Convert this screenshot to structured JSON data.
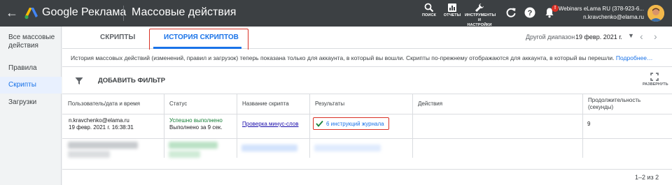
{
  "app": {
    "brand": "Google Реклама",
    "page_title": "Массовые действия"
  },
  "toolbar": {
    "search_label": "ПОИСК",
    "reports_label": "ОТЧЕТЫ",
    "tools_label_line1": "ИНСТРУМЕНТЫ",
    "tools_label_line2": "И",
    "tools_label_line3": "НАСТРОЙКИ",
    "notification_count": "!"
  },
  "account": {
    "name": "Webinars eLama RU (378-923-6...",
    "email": "n.kravchenko@elama.ru"
  },
  "sidebar": {
    "items": [
      {
        "label": "Все массовые действия"
      },
      {
        "label": "Правила"
      },
      {
        "label": "Скрипты"
      },
      {
        "label": "Загрузки"
      }
    ]
  },
  "tabs": [
    {
      "label": "СКРИПТЫ"
    },
    {
      "label": "ИСТОРИЯ СКРИПТОВ"
    }
  ],
  "date_range": {
    "label": "Другой диапазон",
    "value": "19 февр. 2021 г."
  },
  "info": {
    "text": "История массовых действий (изменений, правил и загрузок) теперь показана только для аккаунта, в который вы вошли. Скрипты по-прежнему отображаются для аккаунта, в который вы перешли.",
    "more_link": "Подробнее…"
  },
  "filter": {
    "label": "ДОБАВИТЬ ФИЛЬТР",
    "expand_label": "РАЗВЕРНУТЬ"
  },
  "table": {
    "headers": {
      "user": "Пользователь/дата и время",
      "status": "Статус",
      "script": "Название скрипта",
      "results": "Результаты",
      "actions": "Действия",
      "duration_line1": "Продолжительность",
      "duration_line2": "(секунды)"
    },
    "rows": [
      {
        "user": "n.kravchenko@elama.ru",
        "datetime": "19 февр. 2021 г. 16:38:31",
        "status": "Успешно выполнено",
        "status_detail": "Выполнено за 9 сек.",
        "script": "Проверка минус-слов",
        "results": "6 инструкций журнала",
        "actions": "",
        "duration": "9"
      }
    ]
  },
  "pagination": {
    "text": "1–2 из 2"
  },
  "colors": {
    "topbar": "#3c4043",
    "accent": "#1a73e8",
    "success": "#188038",
    "highlight": "#d93025"
  }
}
